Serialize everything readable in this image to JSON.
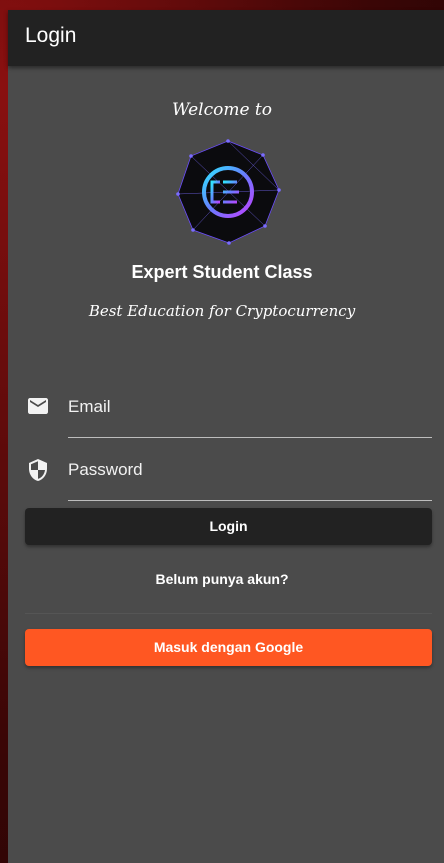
{
  "appbar": {
    "title": "Login"
  },
  "header": {
    "welcome": "Welcome to",
    "app_name": "Expert Student Class",
    "tagline": "Best Education for Cryptocurrency",
    "logo_icon": "esc-logo"
  },
  "form": {
    "email_placeholder": "Email",
    "password_placeholder": "Password",
    "email_icon": "mail-icon",
    "password_icon": "shield-icon",
    "login_label": "Login",
    "register_label": "Belum punya akun?",
    "google_label": "Masuk dengan Google"
  },
  "colors": {
    "appbar": "#222222",
    "panel": "#4b4b4b",
    "login_button": "#222222",
    "google_button": "#ff5722"
  }
}
